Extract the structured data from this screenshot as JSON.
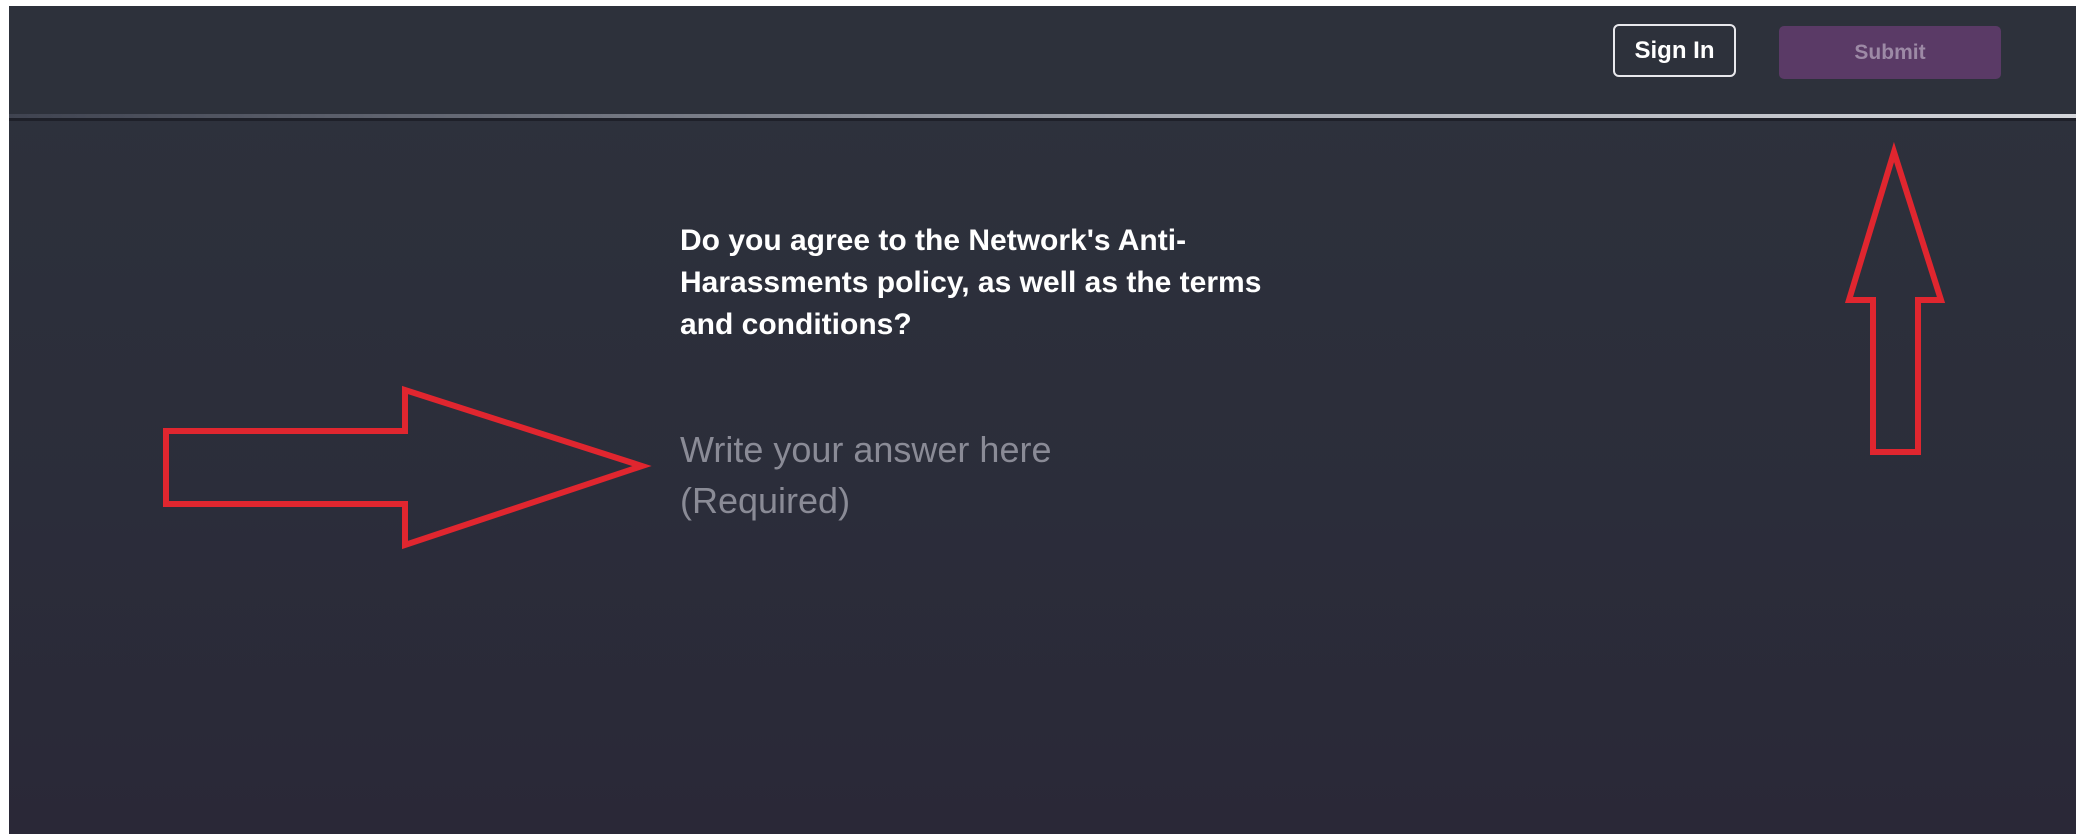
{
  "header": {
    "sign_in_label": "Sign In",
    "submit_label": "Submit"
  },
  "form": {
    "question": "Do you agree to the Network's Anti-Harassments policy, as well as the terms and conditions?",
    "answer_placeholder": "Write your answer here\n(Required)",
    "answer_value": ""
  },
  "colors": {
    "background": "#2d313b",
    "submit_bg": "#5a3a66",
    "annotation_arrow": "#e0262f"
  },
  "annotations": [
    {
      "icon": "red-arrow-right",
      "target": "answer-input"
    },
    {
      "icon": "red-arrow-up",
      "target": "submit-button"
    }
  ]
}
